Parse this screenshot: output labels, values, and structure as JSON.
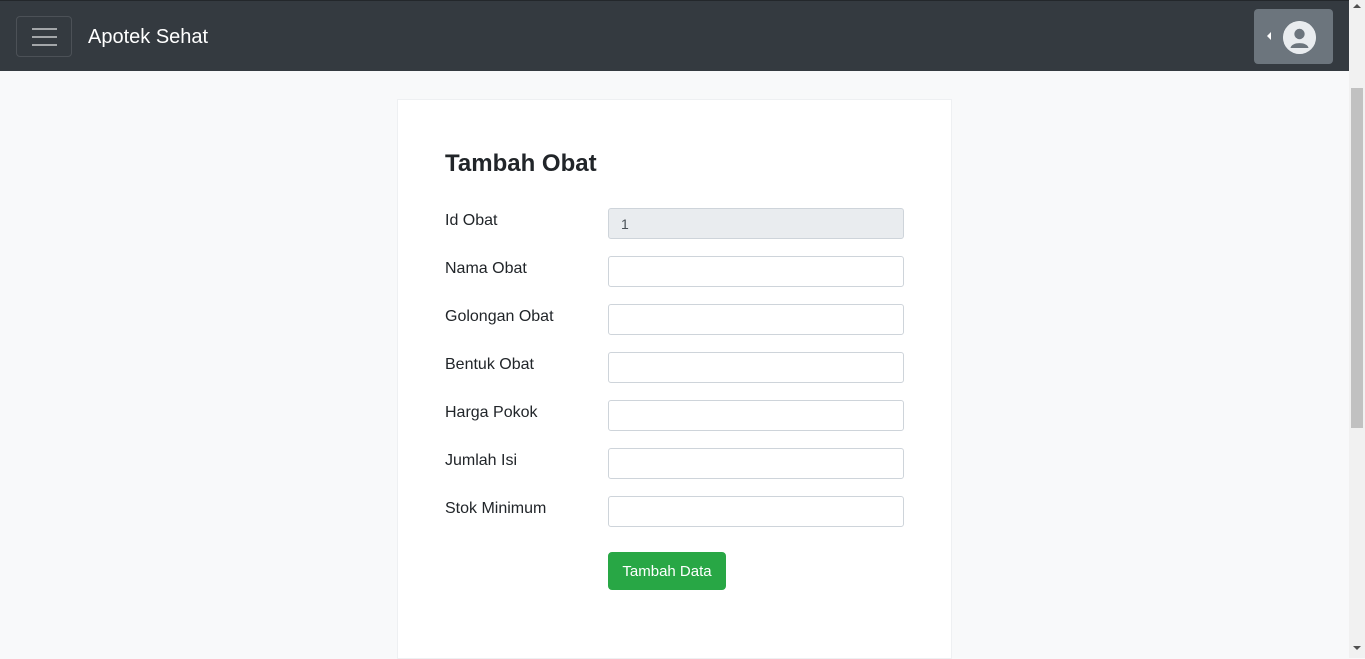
{
  "navbar": {
    "brand": "Apotek Sehat",
    "toggle_icon": "hamburger-menu-icon",
    "user_icon": "user-circle-icon",
    "caret_icon": "caret-left-icon",
    "background": "#343a40"
  },
  "form": {
    "title": "Tambah Obat",
    "fields": [
      {
        "label": "Id Obat",
        "value": "1",
        "readonly": true
      },
      {
        "label": "Nama Obat",
        "value": ""
      },
      {
        "label": "Golongan Obat",
        "value": ""
      },
      {
        "label": "Bentuk Obat",
        "value": ""
      },
      {
        "label": "Harga Pokok",
        "value": ""
      },
      {
        "label": "Jumlah Isi",
        "value": ""
      },
      {
        "label": "Stok Minimum",
        "value": ""
      }
    ],
    "submit_label": "Tambah Data",
    "submit_color": "#28a745"
  }
}
